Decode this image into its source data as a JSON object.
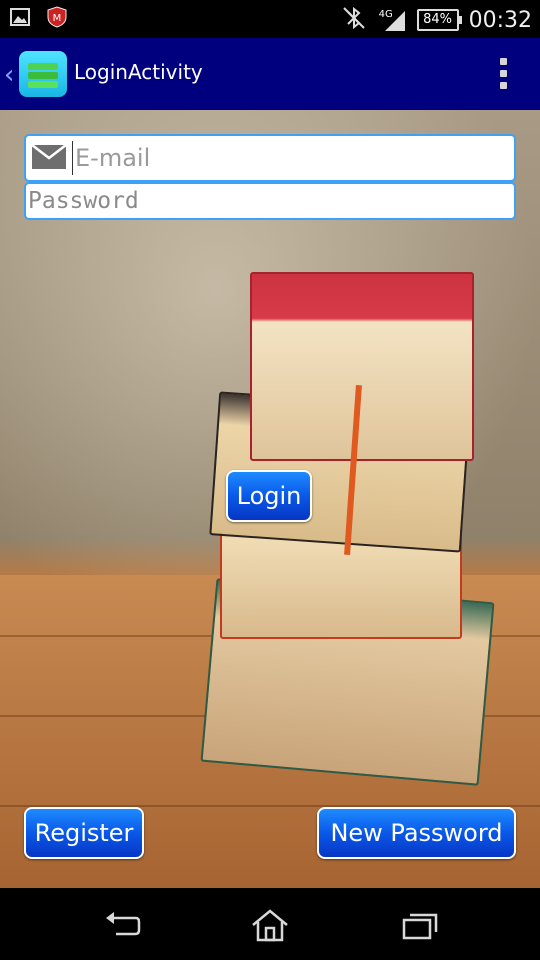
{
  "status_bar": {
    "network_type": "4G",
    "battery_level": "84%",
    "time": "00:32",
    "icons": [
      "gallery-notification-icon",
      "mcafee-icon",
      "bluetooth-off-icon",
      "signal-icon",
      "battery-icon"
    ]
  },
  "action_bar": {
    "title": "LoginActivity",
    "background_color": "#00007f"
  },
  "form": {
    "email_placeholder": "E-mail",
    "email_value": "",
    "password_placeholder": "Password",
    "password_value": ""
  },
  "buttons": {
    "login_label": "Login",
    "register_label": "Register",
    "new_password_label": "New Password"
  },
  "navigation": {
    "icons": [
      "back-icon",
      "home-icon",
      "recent-apps-icon"
    ]
  }
}
